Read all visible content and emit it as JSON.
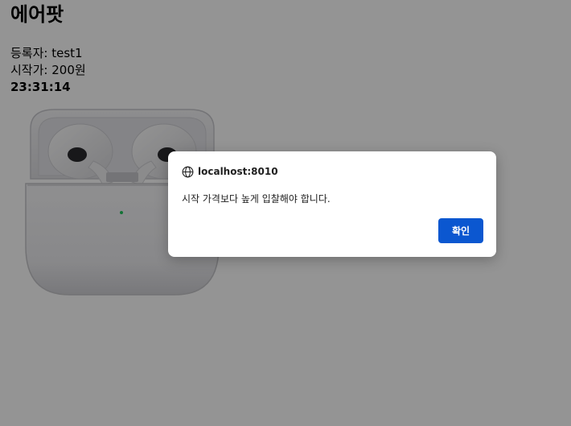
{
  "page": {
    "title": "에어팟",
    "registrant_label": "등록자:",
    "registrant": "test1",
    "start_price_label": "시작가:",
    "start_price": "200원",
    "timer": "23:31:14",
    "product_image": "airpods-case-image"
  },
  "dialog": {
    "origin": "localhost:8010",
    "origin_icon": "globe-icon",
    "message": "시작 가격보다 높게 입찰해야 합니다.",
    "ok_label": "확인",
    "ok_color": "#0b57d0"
  },
  "colors": {
    "overlay": "rgba(0,0,0,0.42)",
    "led": "#22c55e"
  }
}
